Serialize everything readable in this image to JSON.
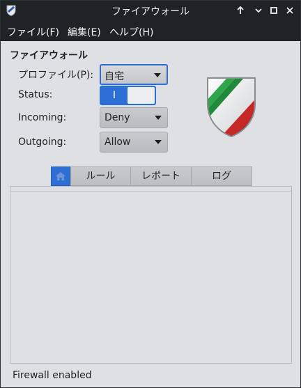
{
  "window": {
    "title": "ファイアウォール",
    "controls": {
      "keep_above": "↑",
      "minimize": "▾",
      "maximize": "□",
      "close": "✕"
    }
  },
  "menu": [
    "ファイル(F)",
    "編集(E)",
    "ヘルプ(H)"
  ],
  "section_title": "ファイアウォール",
  "profile": {
    "label": "プロファイル(P):",
    "value": "自宅"
  },
  "status_row": {
    "label": "Status:",
    "switch_text": "I",
    "enabled": true
  },
  "incoming": {
    "label": "Incoming:",
    "value": "Deny"
  },
  "outgoing": {
    "label": "Outgoing:",
    "value": "Allow"
  },
  "tabs": {
    "home_icon": "home-icon",
    "items": [
      "ルール",
      "レポート",
      "ログ"
    ]
  },
  "statusbar": "Firewall enabled",
  "colors": {
    "accent": "#2e6fd6",
    "titlebar": "#202326",
    "window_bg": "#dfe0e3"
  }
}
